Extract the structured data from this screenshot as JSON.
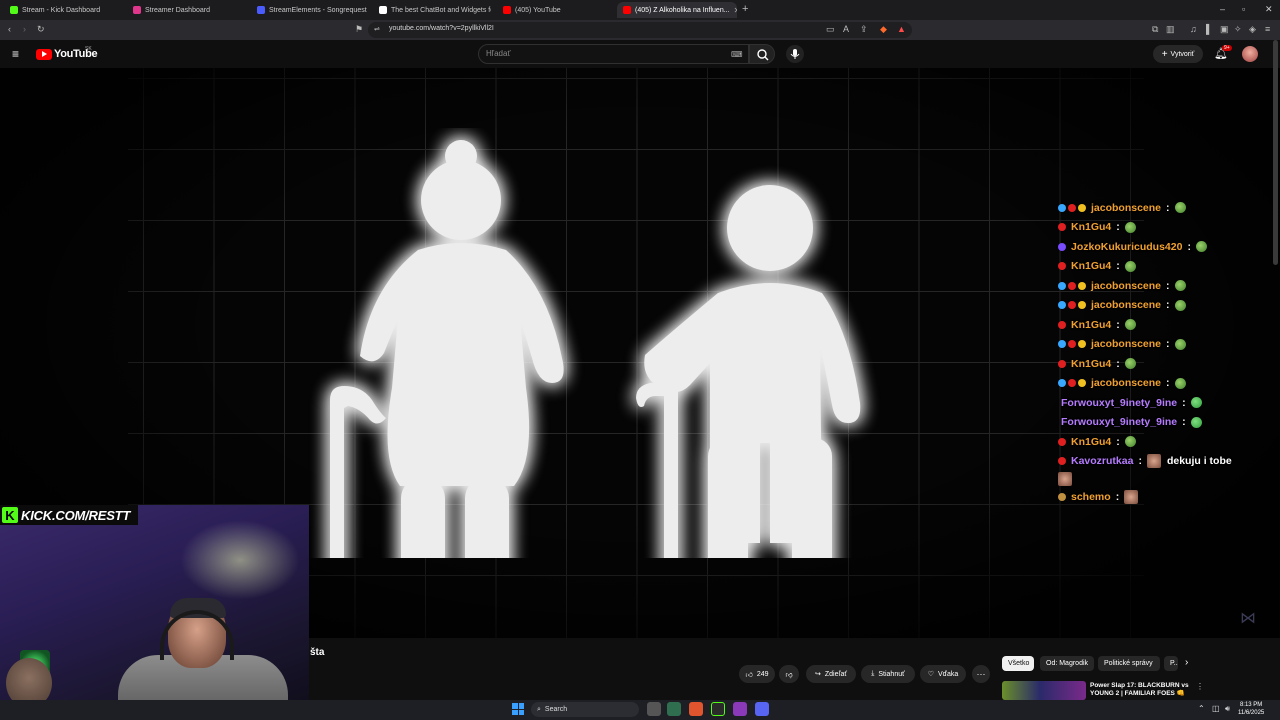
{
  "browser": {
    "tabs": [
      {
        "label": "Stream - Kick Dashboard",
        "color": "#53fc18"
      },
      {
        "label": "Streamer Dashboard",
        "color": "#e0368c"
      },
      {
        "label": "StreamElements - Songrequest",
        "color": "#4b5cff"
      },
      {
        "label": "The best ChatBot and Widgets for K...",
        "color": "#ffffff"
      },
      {
        "label": "(405) YouTube",
        "color": "#ff0000"
      },
      {
        "label": "(405) Z Alkoholika na Influen...",
        "color": "#ff0000",
        "active": true
      }
    ],
    "new_tab": "+",
    "url": "youtube.com/watch?v=2pyllkiVll2I"
  },
  "youtube": {
    "logo": "YouTube",
    "country": "SK",
    "search_placeholder": "Hľadať",
    "create_label": "Vytvoriť",
    "notif_count": "9+"
  },
  "chat": [
    {
      "user": "jacobonscene",
      "color": "#f0a030",
      "badges": [
        "#38a8ff",
        "#e02020",
        "#f0c020"
      ]
    },
    {
      "user": "Kn1Gu4",
      "color": "#f0a030",
      "badges": [
        "#e02020"
      ]
    },
    {
      "user": "JozkoKukuricudus420",
      "color": "#f0a030",
      "badges": [
        "#7a4cff"
      ]
    },
    {
      "user": "Kn1Gu4",
      "color": "#f0a030",
      "badges": [
        "#e02020"
      ]
    },
    {
      "user": "jacobonscene",
      "color": "#f0a030",
      "badges": [
        "#38a8ff",
        "#e02020",
        "#f0c020"
      ]
    },
    {
      "user": "jacobonscene",
      "color": "#f0a030",
      "badges": [
        "#38a8ff",
        "#e02020",
        "#f0c020"
      ]
    },
    {
      "user": "Kn1Gu4",
      "color": "#f0a030",
      "badges": [
        "#e02020"
      ]
    },
    {
      "user": "jacobonscene",
      "color": "#f0a030",
      "badges": [
        "#38a8ff",
        "#e02020",
        "#f0c020"
      ]
    },
    {
      "user": "Kn1Gu4",
      "color": "#f0a030",
      "badges": [
        "#e02020"
      ]
    },
    {
      "user": "jacobonscene",
      "color": "#f0a030",
      "badges": [
        "#38a8ff",
        "#e02020",
        "#f0c020"
      ]
    },
    {
      "user": "Forwouxyt_9inety_9ine",
      "color": "#b57cff",
      "badges": []
    },
    {
      "user": "Forwouxyt_9inety_9ine",
      "color": "#b57cff",
      "badges": []
    },
    {
      "user": "Kn1Gu4",
      "color": "#f0a030",
      "badges": [
        "#e02020"
      ]
    },
    {
      "user": "Kavozrutkaa",
      "color": "#b57cff",
      "badges": [
        "#e02020"
      ],
      "text": "dekuju i tobe"
    },
    {
      "user": "schemo",
      "color": "#f0a030",
      "badges": [
        "#c09040"
      ]
    }
  ],
  "overlay": {
    "kick_url": "KICK.COM/RESTT"
  },
  "video": {
    "title_fragment": "šta",
    "likes": "249",
    "share": "Zdieľať",
    "download": "Stiahnuť",
    "thanks": "Vďaka",
    "more": "···"
  },
  "chips": [
    "Všetko",
    "Od: Magrodik",
    "Politické správy",
    "P..."
  ],
  "recommendation": {
    "title": "Power Slap 17: BLACKBURN vs YOUNG 2 | FAMILIAR FOES 👊"
  },
  "taskbar": {
    "search": "Search",
    "time": "8:13 PM",
    "date": "11/6/2025"
  }
}
